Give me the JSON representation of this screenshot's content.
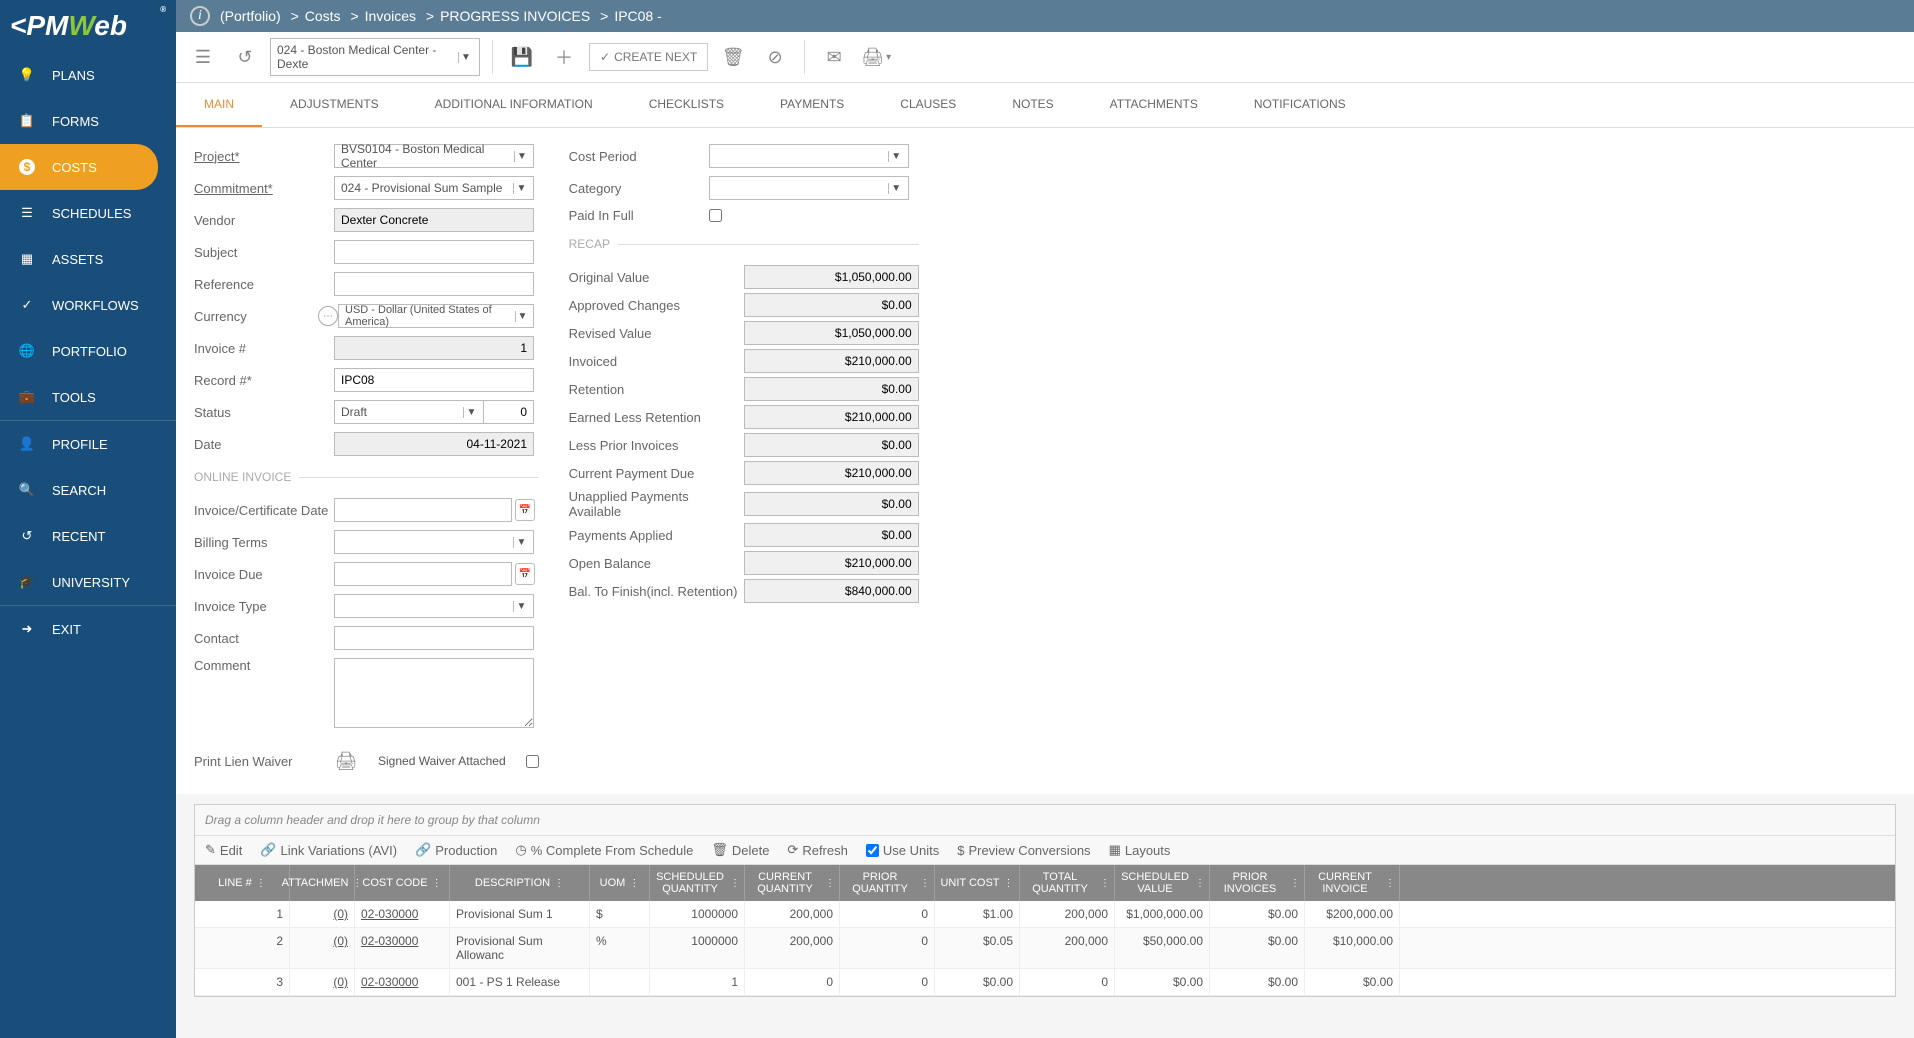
{
  "breadcrumb": {
    "root": "(Portfolio)",
    "parts": [
      "Costs",
      "Invoices",
      "PROGRESS INVOICES",
      "IPC08 -"
    ]
  },
  "toolbar": {
    "portfolio_dd": "024 - Boston Medical Center - Dexte",
    "create_next": "CREATE NEXT"
  },
  "nav": {
    "items": [
      "PLANS",
      "FORMS",
      "COSTS",
      "SCHEDULES",
      "ASSETS",
      "WORKFLOWS",
      "PORTFOLIO",
      "TOOLS",
      "PROFILE",
      "SEARCH",
      "RECENT",
      "UNIVERSITY",
      "EXIT"
    ]
  },
  "tabs": [
    "MAIN",
    "ADJUSTMENTS",
    "ADDITIONAL INFORMATION",
    "CHECKLISTS",
    "PAYMENTS",
    "CLAUSES",
    "NOTES",
    "ATTACHMENTS",
    "NOTIFICATIONS"
  ],
  "form": {
    "project_label": "Project*",
    "project": "BVS0104 - Boston Medical Center",
    "commitment_label": "Commitment*",
    "commitment": "024 - Provisional Sum Sample",
    "vendor_label": "Vendor",
    "vendor": "Dexter Concrete",
    "subject_label": "Subject",
    "subject": "",
    "reference_label": "Reference",
    "reference": "",
    "currency_label": "Currency",
    "currency": "USD - Dollar (United States of America)",
    "invoice_no_label": "Invoice #",
    "invoice_no": "1",
    "record_label": "Record #*",
    "record": "IPC08",
    "status_label": "Status",
    "status": "Draft",
    "status_num": "0",
    "date_label": "Date",
    "date": "04-11-2021",
    "online_invoice": "ONLINE INVOICE",
    "invcert_label": "Invoice/Certificate Date",
    "invcert": "",
    "billing_label": "Billing Terms",
    "billing": "",
    "due_label": "Invoice Due",
    "due": "",
    "type_label": "Invoice Type",
    "type": "",
    "contact_label": "Contact",
    "contact": "",
    "comment_label": "Comment",
    "comment": "",
    "lien_label": "Print Lien Waiver",
    "signed_label": "Signed Waiver Attached",
    "cost_period_label": "Cost Period",
    "cost_period": "",
    "category_label": "Category",
    "category": "",
    "paid_full_label": "Paid In Full"
  },
  "recap": {
    "title": "RECAP",
    "rows": [
      {
        "label": "Original Value",
        "value": "$1,050,000.00"
      },
      {
        "label": "Approved Changes",
        "value": "$0.00"
      },
      {
        "label": "Revised Value",
        "value": "$1,050,000.00"
      },
      {
        "label": "Invoiced",
        "value": "$210,000.00"
      },
      {
        "label": "Retention",
        "value": "$0.00"
      },
      {
        "label": "Earned Less Retention",
        "value": "$210,000.00"
      },
      {
        "label": "Less Prior Invoices",
        "value": "$0.00"
      },
      {
        "label": "Current Payment Due",
        "value": "$210,000.00"
      },
      {
        "label": "Unapplied Payments Available",
        "value": "$0.00"
      },
      {
        "label": "Payments Applied",
        "value": "$0.00"
      },
      {
        "label": "Open Balance",
        "value": "$210,000.00"
      },
      {
        "label": "Bal. To Finish(incl. Retention)",
        "value": "$840,000.00"
      }
    ]
  },
  "grid": {
    "group_hint": "Drag a column header and drop it here to group by that column",
    "tb": {
      "edit": "Edit",
      "link": "Link Variations (AVI)",
      "prod": "Production",
      "pct": "% Complete From Schedule",
      "del": "Delete",
      "refresh": "Refresh",
      "units": "Use Units",
      "preview": "Preview Conversions",
      "layouts": "Layouts"
    },
    "headers": [
      "LINE #",
      "ATTACHMEN",
      "COST CODE",
      "DESCRIPTION",
      "UOM",
      "SCHEDULED QUANTITY",
      "CURRENT QUANTITY",
      "PRIOR QUANTITY",
      "UNIT COST",
      "TOTAL QUANTITY",
      "SCHEDULED VALUE",
      "PRIOR INVOICES",
      "CURRENT INVOICE"
    ],
    "rows": [
      {
        "line": "1",
        "attach": "(0)",
        "code": "02-030000",
        "desc": "Provisional Sum 1",
        "uom": "$",
        "schedq": "1000000",
        "currq": "200,000",
        "priorq": "0",
        "unit": "$1.00",
        "totalq": "200,000",
        "schedv": "$1,000,000.00",
        "priorinv": "$0.00",
        "currinv": "$200,000.00"
      },
      {
        "line": "2",
        "attach": "(0)",
        "code": "02-030000",
        "desc": "Provisional Sum Allowanc",
        "uom": "%",
        "schedq": "1000000",
        "currq": "200,000",
        "priorq": "0",
        "unit": "$0.05",
        "totalq": "200,000",
        "schedv": "$50,000.00",
        "priorinv": "$0.00",
        "currinv": "$10,000.00"
      },
      {
        "line": "3",
        "attach": "(0)",
        "code": "02-030000",
        "desc": "001 - PS 1 Release",
        "uom": "",
        "schedq": "1",
        "currq": "0",
        "priorq": "0",
        "unit": "$0.00",
        "totalq": "0",
        "schedv": "$0.00",
        "priorinv": "$0.00",
        "currinv": "$0.00"
      }
    ]
  }
}
